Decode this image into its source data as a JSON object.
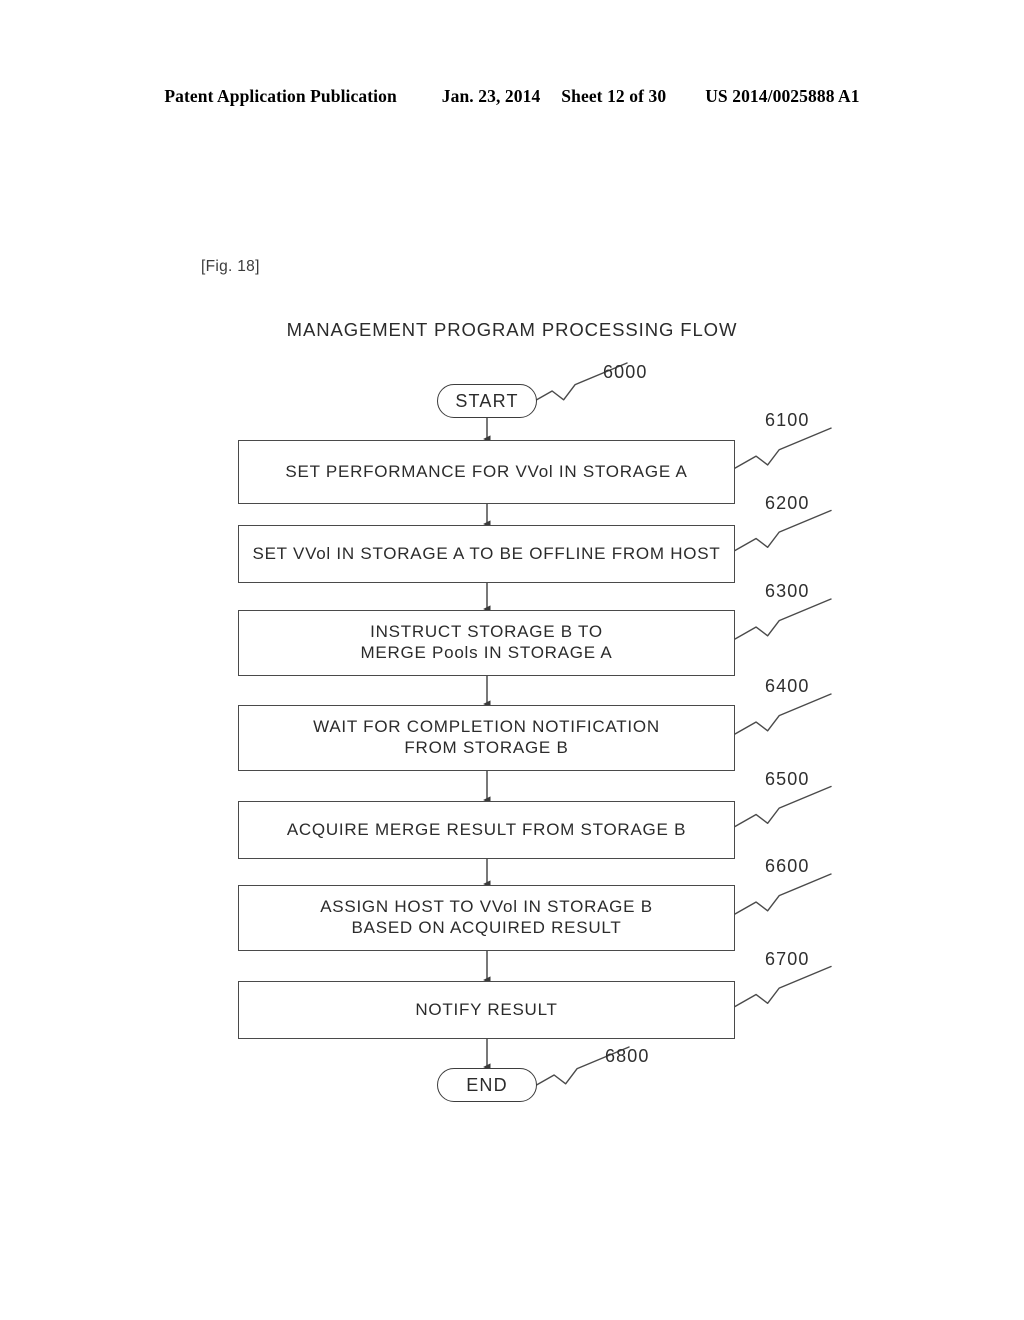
{
  "header": {
    "publication": "Patent Application Publication",
    "date": "Jan. 23, 2014",
    "sheet": "Sheet 12 of 30",
    "docnumber": "US 2014/0025888 A1"
  },
  "figure": {
    "label": "[Fig. 18]",
    "title": "MANAGEMENT PROGRAM PROCESSING FLOW"
  },
  "flow": {
    "start": {
      "label": "START",
      "ref": "6000"
    },
    "end": {
      "label": "END",
      "ref": "6800"
    },
    "steps": [
      {
        "ref": "6100",
        "lines": [
          "SET PERFORMANCE FOR VVol IN STORAGE A"
        ]
      },
      {
        "ref": "6200",
        "lines": [
          "SET VVol IN STORAGE A TO BE OFFLINE FROM HOST"
        ]
      },
      {
        "ref": "6300",
        "lines": [
          "INSTRUCT STORAGE B TO",
          "MERGE Pools IN STORAGE A"
        ]
      },
      {
        "ref": "6400",
        "lines": [
          "WAIT FOR COMPLETION NOTIFICATION",
          "FROM STORAGE B"
        ]
      },
      {
        "ref": "6500",
        "lines": [
          "ACQUIRE MERGE RESULT FROM STORAGE B"
        ]
      },
      {
        "ref": "6600",
        "lines": [
          "ASSIGN HOST TO VVol IN STORAGE B",
          "BASED ON ACQUIRED RESULT"
        ]
      },
      {
        "ref": "6700",
        "lines": [
          "NOTIFY RESULT"
        ]
      }
    ]
  },
  "colors": {
    "ink": "#2b2b2b",
    "line": "#4a4a4a",
    "paper": "#ffffff"
  }
}
